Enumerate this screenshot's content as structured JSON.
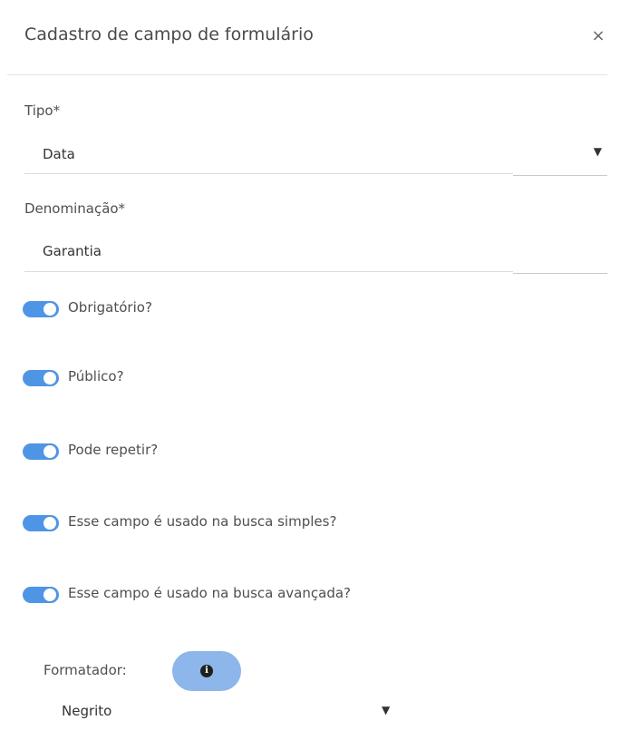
{
  "dialog": {
    "title": "Cadastro de campo de formulário",
    "close_icon": "close-icon",
    "close_glyph": "×"
  },
  "form": {
    "tipo": {
      "label": "Tipo*",
      "value": "Data"
    },
    "denominacao": {
      "label": "Denominação*",
      "value": "Garantia"
    },
    "toggles": [
      {
        "label": "Obrigatório?",
        "on": true
      },
      {
        "label": "Público?",
        "on": true
      },
      {
        "label": "Pode repetir?",
        "on": true
      },
      {
        "label": "Esse campo é usado na busca simples?",
        "on": true
      },
      {
        "label": "Esse campo é usado na busca avançada?",
        "on": true
      }
    ],
    "formatador": {
      "label": "Formatador:",
      "info_icon": "info-icon",
      "info_glyph": "i",
      "value": "Negrito"
    },
    "dropdown_glyph": "▼"
  },
  "colors": {
    "toggle_on": "#4f95e6",
    "info_button": "#8db6ea"
  }
}
